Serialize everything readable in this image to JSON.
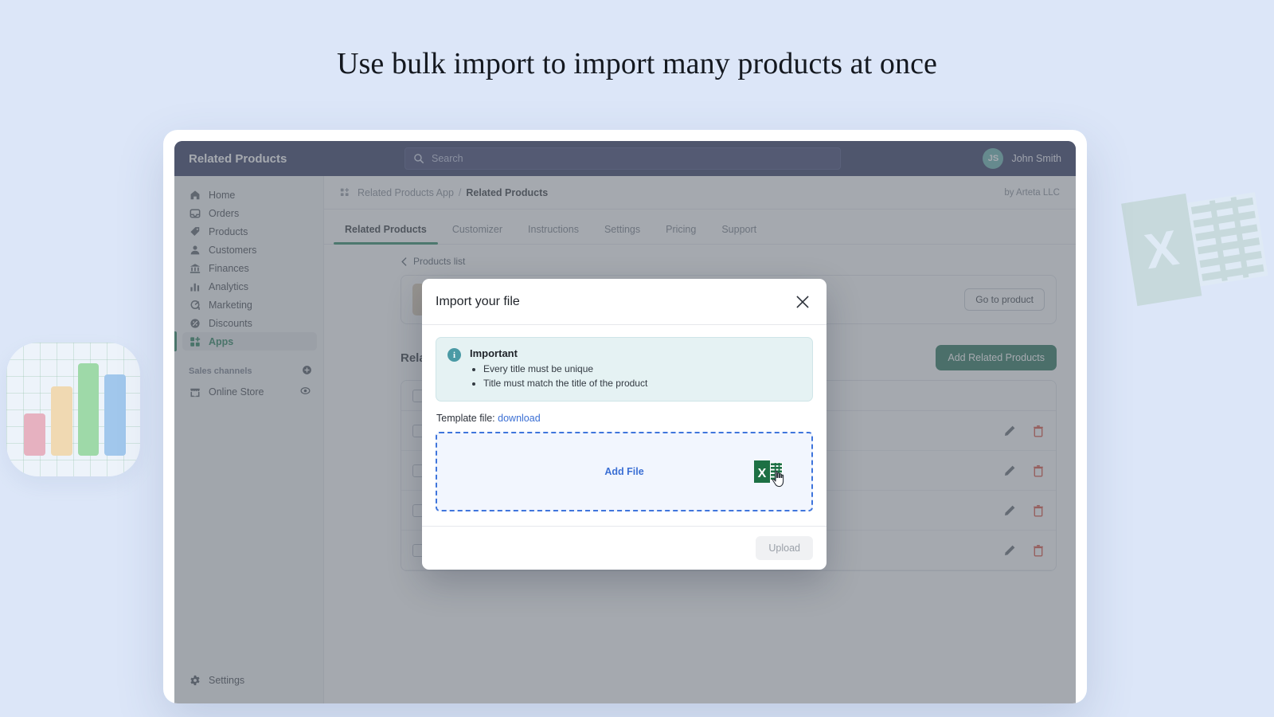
{
  "headline": "Use bulk import to import many products at once",
  "topbar": {
    "brand": "Related Products",
    "search_placeholder": "Search",
    "search_value": "",
    "avatar_initials": "JS",
    "user_name": "John Smith"
  },
  "sidebar": {
    "items": [
      {
        "label": "Home",
        "icon": "home-icon"
      },
      {
        "label": "Orders",
        "icon": "orders-icon"
      },
      {
        "label": "Products",
        "icon": "tag-icon"
      },
      {
        "label": "Customers",
        "icon": "person-icon"
      },
      {
        "label": "Finances",
        "icon": "bank-icon"
      },
      {
        "label": "Analytics",
        "icon": "bars-icon"
      },
      {
        "label": "Marketing",
        "icon": "megaphone-icon"
      },
      {
        "label": "Discounts",
        "icon": "discount-icon"
      },
      {
        "label": "Apps",
        "icon": "apps-icon"
      }
    ],
    "section_label": "Sales channels",
    "channel": {
      "label": "Online Store",
      "icon": "store-icon"
    },
    "settings": {
      "label": "Settings",
      "icon": "gear-icon"
    }
  },
  "breadcrumb": {
    "app": "Related Products App",
    "separator": "/",
    "current": "Related Products",
    "author": "by Arteta LLC"
  },
  "tabs": [
    {
      "label": "Related Products",
      "active": true
    },
    {
      "label": "Customizer",
      "active": false
    },
    {
      "label": "Instructions",
      "active": false
    },
    {
      "label": "Settings",
      "active": false
    },
    {
      "label": "Pricing",
      "active": false
    },
    {
      "label": "Support",
      "active": false
    }
  ],
  "page": {
    "back_label": "Products list",
    "go_to_product": "Go to product",
    "section_title": "Related Products",
    "add_button": "Add Related Products"
  },
  "modal": {
    "title": "Import your file",
    "close_label": "✕",
    "callout": {
      "title": "Important",
      "bullets": [
        "Every title must be unique",
        "Title must match the title of the product"
      ]
    },
    "template_label": "Template file:",
    "template_link": "download",
    "dropzone_label": "Add File",
    "upload_button": "Upload"
  },
  "colors": {
    "page_bg": "#dce6f8",
    "topbar": "#1f2552",
    "accent_green": "#14664a",
    "link_blue": "#3b6fd4",
    "info_teal": "#4a9aa5",
    "danger_red": "#d8412f"
  }
}
